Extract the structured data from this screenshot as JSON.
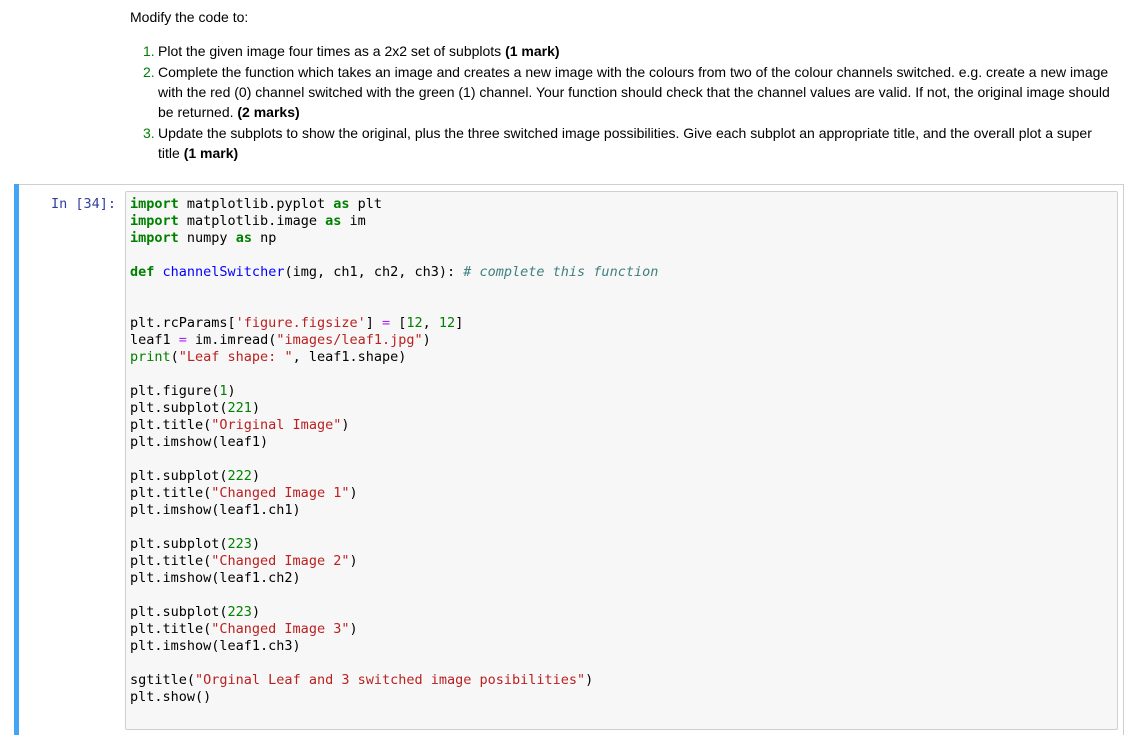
{
  "markdown": {
    "intro": "Modify the code to:",
    "items": [
      {
        "number": "1.",
        "text": "Plot the given image four times as a 2x2 set of subplots ",
        "mark": "(1 mark)",
        "tail": ""
      },
      {
        "number": "2.",
        "text": "Complete the function which takes an image and creates a new image with the colours from two of the colour channels switched. e.g. create a new image with the red (0) channel switched with the green (1) channel. Your function should check that the channel values are valid. If not, the original image should be returned. ",
        "mark": "(2 marks)",
        "tail": ""
      },
      {
        "number": "3.",
        "text": "Update the subplots to show the original, plus the three switched image possibilities. Give each subplot an appropriate title, and the overall plot a super title ",
        "mark": "(1 mark)",
        "tail": ""
      }
    ]
  },
  "code_cell": {
    "prompt": "In [34]:",
    "colors": {
      "selected_edge": "#42a5f5",
      "keyword": "#008000",
      "function_name": "#0000ff",
      "string": "#ba2121",
      "number": "#008000",
      "operator": "#aa22ff",
      "comment": "#408080",
      "prompt": "#303f9f"
    },
    "lines": [
      [
        {
          "t": "kw",
          "v": "import"
        },
        {
          "t": "",
          "v": " matplotlib.pyplot "
        },
        {
          "t": "kw",
          "v": "as"
        },
        {
          "t": "",
          "v": " plt"
        }
      ],
      [
        {
          "t": "kw",
          "v": "import"
        },
        {
          "t": "",
          "v": " matplotlib.image "
        },
        {
          "t": "kw",
          "v": "as"
        },
        {
          "t": "",
          "v": " im"
        }
      ],
      [
        {
          "t": "kw",
          "v": "import"
        },
        {
          "t": "",
          "v": " numpy "
        },
        {
          "t": "kw",
          "v": "as"
        },
        {
          "t": "",
          "v": " np"
        }
      ],
      [],
      [
        {
          "t": "kw",
          "v": "def"
        },
        {
          "t": "",
          "v": " "
        },
        {
          "t": "fn",
          "v": "channelSwitcher"
        },
        {
          "t": "",
          "v": "(img, ch1, ch2, ch3): "
        },
        {
          "t": "cm",
          "v": "# complete this function"
        }
      ],
      [],
      [],
      [
        {
          "t": "",
          "v": "plt.rcParams["
        },
        {
          "t": "str",
          "v": "'figure.figsize'"
        },
        {
          "t": "",
          "v": "] "
        },
        {
          "t": "op",
          "v": "="
        },
        {
          "t": "",
          "v": " ["
        },
        {
          "t": "num",
          "v": "12"
        },
        {
          "t": "",
          "v": ", "
        },
        {
          "t": "num",
          "v": "12"
        },
        {
          "t": "",
          "v": "]"
        }
      ],
      [
        {
          "t": "",
          "v": "leaf1 "
        },
        {
          "t": "op",
          "v": "="
        },
        {
          "t": "",
          "v": " im.imread("
        },
        {
          "t": "str",
          "v": "\"images/leaf1.jpg\""
        },
        {
          "t": "",
          "v": ")"
        }
      ],
      [
        {
          "t": "bi",
          "v": "print"
        },
        {
          "t": "",
          "v": "("
        },
        {
          "t": "str",
          "v": "\"Leaf shape: \""
        },
        {
          "t": "",
          "v": ", leaf1.shape)"
        }
      ],
      [],
      [
        {
          "t": "",
          "v": "plt.figure("
        },
        {
          "t": "num",
          "v": "1"
        },
        {
          "t": "",
          "v": ")"
        }
      ],
      [
        {
          "t": "",
          "v": "plt.subplot("
        },
        {
          "t": "num",
          "v": "221"
        },
        {
          "t": "",
          "v": ")"
        }
      ],
      [
        {
          "t": "",
          "v": "plt.title("
        },
        {
          "t": "str",
          "v": "\"Original Image\""
        },
        {
          "t": "",
          "v": ")"
        }
      ],
      [
        {
          "t": "",
          "v": "plt.imshow(leaf1)"
        }
      ],
      [],
      [
        {
          "t": "",
          "v": "plt.subplot("
        },
        {
          "t": "num",
          "v": "222"
        },
        {
          "t": "",
          "v": ")"
        }
      ],
      [
        {
          "t": "",
          "v": "plt.title("
        },
        {
          "t": "str",
          "v": "\"Changed Image 1\""
        },
        {
          "t": "",
          "v": ")"
        }
      ],
      [
        {
          "t": "",
          "v": "plt.imshow(leaf1.ch1)"
        }
      ],
      [],
      [
        {
          "t": "",
          "v": "plt.subplot("
        },
        {
          "t": "num",
          "v": "223"
        },
        {
          "t": "",
          "v": ")"
        }
      ],
      [
        {
          "t": "",
          "v": "plt.title("
        },
        {
          "t": "str",
          "v": "\"Changed Image 2\""
        },
        {
          "t": "",
          "v": ")"
        }
      ],
      [
        {
          "t": "",
          "v": "plt.imshow(leaf1.ch2)"
        }
      ],
      [],
      [
        {
          "t": "",
          "v": "plt.subplot("
        },
        {
          "t": "num",
          "v": "223"
        },
        {
          "t": "",
          "v": ")"
        }
      ],
      [
        {
          "t": "",
          "v": "plt.title("
        },
        {
          "t": "str",
          "v": "\"Changed Image 3\""
        },
        {
          "t": "",
          "v": ")"
        }
      ],
      [
        {
          "t": "",
          "v": "plt.imshow(leaf1.ch3)"
        }
      ],
      [],
      [
        {
          "t": "",
          "v": "sgtitle("
        },
        {
          "t": "str",
          "v": "\"Orginal Leaf and 3 switched image posibilities\""
        },
        {
          "t": "",
          "v": ")"
        }
      ],
      [
        {
          "t": "",
          "v": "plt.show()"
        }
      ]
    ]
  }
}
